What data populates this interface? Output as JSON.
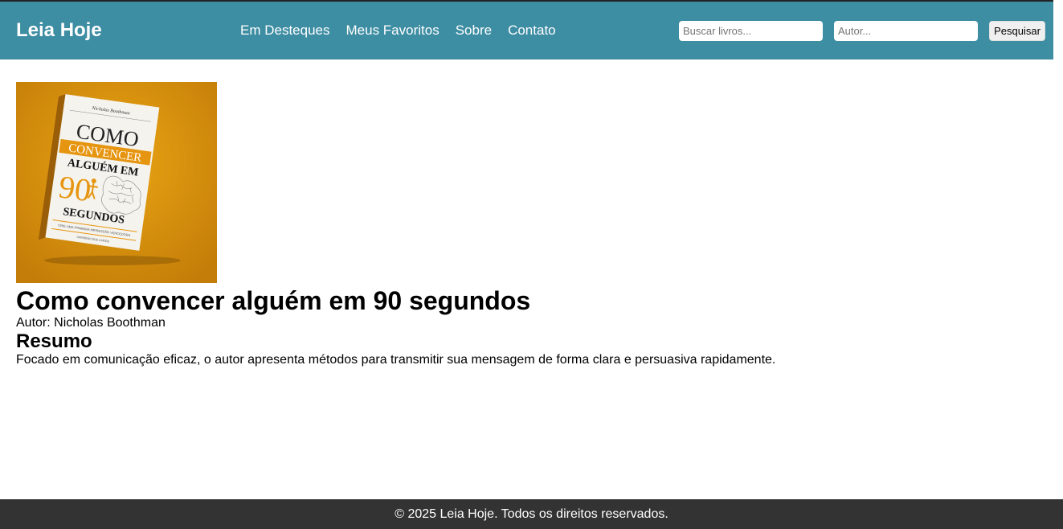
{
  "header": {
    "brand": "Leia Hoje",
    "nav": [
      {
        "label": "Em Desteques"
      },
      {
        "label": "Meus Favoritos"
      },
      {
        "label": "Sobre"
      },
      {
        "label": "Contato"
      }
    ],
    "search": {
      "title_placeholder": "Buscar livros...",
      "title_value": "",
      "author_placeholder": "Autor...",
      "author_value": "",
      "button_label": "Pesquisar"
    }
  },
  "book": {
    "cover": {
      "author_line": "Nicholas Boothman",
      "line1": "COMO",
      "line2": "CONVENCER",
      "line3": "ALGUÉM EM",
      "number": "90",
      "line4": "SEGUNDOS",
      "subtitle": "CRIE UMA PRIMEIRA IMPRESSÃO VENCEDORA",
      "publisher": "UNIVERSO DOS LIVROS"
    },
    "title": "Como convencer alguém em 90 segundos",
    "author_line": "Autor: Nicholas Boothman",
    "summary_heading": "Resumo",
    "summary_text": "Focado em comunicação eficaz, o autor apresenta métodos para transmitir sua mensagem de forma clara e persuasiva rapidamente."
  },
  "footer": {
    "text": "© 2025 Leia Hoje. Todos os direitos reservados."
  },
  "colors": {
    "navbar": "#3d8da3",
    "footer": "#333333",
    "cover_background": "#e09a0e",
    "cover_accent": "#e69510"
  }
}
